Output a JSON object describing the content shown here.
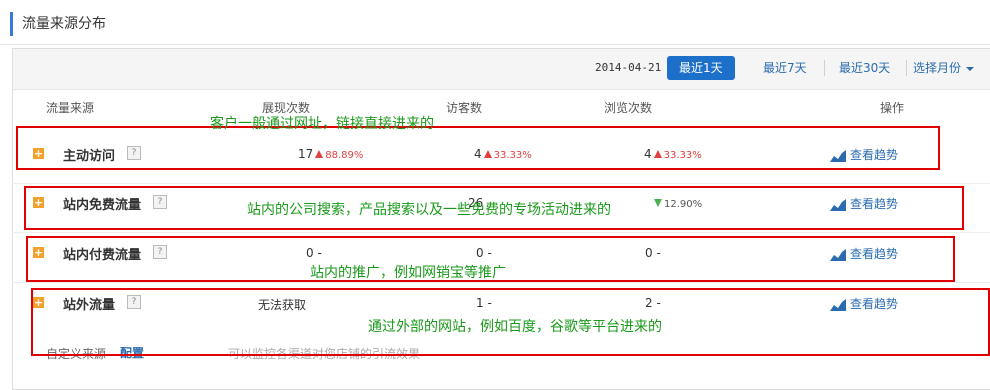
{
  "page_title": "流量来源分布",
  "toolbar": {
    "date": "2014-04-21",
    "btn_1day": "最近1天",
    "btn_7day": "最近7天",
    "btn_30day": "最近30天",
    "btn_month": "选择月份"
  },
  "headers": {
    "source": "流量来源",
    "impressions": "展现次数",
    "visitors": "访客数",
    "pageviews": "浏览次数",
    "action": "操作"
  },
  "rows": [
    {
      "name": "主动访问",
      "impressions": "17",
      "imp_pct": "88.89%",
      "visitors": "4",
      "vis_pct": "33.33%",
      "pageviews": "4",
      "pv_pct": "33.33%",
      "action": "查看趋势"
    },
    {
      "name": "站内免费流量",
      "impressions": "",
      "imp_pct": "",
      "visitors": "26",
      "vis_pct": "",
      "pageviews": "",
      "pv_pct": "12.90%",
      "action": "查看趋势"
    },
    {
      "name": "站内付费流量",
      "impressions": "0 -",
      "visitors": "0 -",
      "pageviews": "0 -",
      "action": "查看趋势"
    },
    {
      "name": "站外流量",
      "impressions": "无法获取",
      "visitors": "1 -",
      "pageviews": "2 -",
      "action": "查看趋势"
    }
  ],
  "annotations": [
    "客户一般通过网址，链接直接进来的",
    "站内的公司搜索，产品搜索以及一些免费的专场活动进来的",
    "站内的推广，例如网销宝等推广",
    "通过外部的网站，例如百度，谷歌等平台进来的"
  ],
  "footer": {
    "label": "自定义来源",
    "link": "配置",
    "hint": "可以监控各渠道对您店铺的引流效果"
  },
  "colors": {
    "accent": "#1d70c9",
    "annotation_box": "#e00000",
    "annotation_text": "#1a9a1a",
    "up": "#e04040",
    "down": "#4caf50",
    "plus": "#f2a12c"
  },
  "icons": {
    "plus": "plus-icon",
    "help": "question-icon",
    "trend": "trend-chart-icon",
    "up": "arrow-up-icon",
    "down": "arrow-down-icon"
  }
}
